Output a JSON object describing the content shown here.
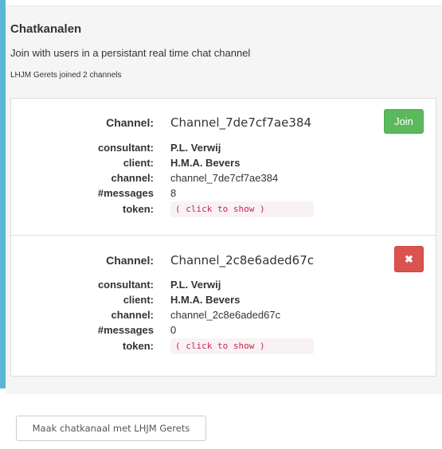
{
  "header": {
    "title": "Chatkanalen",
    "subtitle": "Join with users in a persistant real time chat channel",
    "joined_info": "LHJM Gerets joined 2 channels"
  },
  "labels": {
    "channel_heading": "Channel:",
    "consultant": "consultant:",
    "client": "client:",
    "channel": "channel:",
    "messages": "#messages",
    "token": "token:"
  },
  "channels": [
    {
      "name": "Channel_7de7cf7ae384",
      "consultant": "P.L. Verwij",
      "client": "H.M.A. Bevers",
      "channel_id": "channel_7de7cf7ae384",
      "messages": "8",
      "token": "( click to show )",
      "action_label": "Join",
      "action_color": "#5cb85c"
    },
    {
      "name": "Channel_2c8e6aded67c",
      "consultant": "P.L. Verwij",
      "client": "H.M.A. Bevers",
      "channel_id": "channel_2c8e6aded67c",
      "messages": "0",
      "token": "( click to show )",
      "action_label": "✖",
      "action_icon": "close-icon",
      "action_color": "#d9534f"
    }
  ],
  "footer": {
    "create_button": "Maak chatkanaal met LHJM Gerets"
  },
  "colors": {
    "accent": "#5bb6d6",
    "token_text": "#c7254e"
  }
}
